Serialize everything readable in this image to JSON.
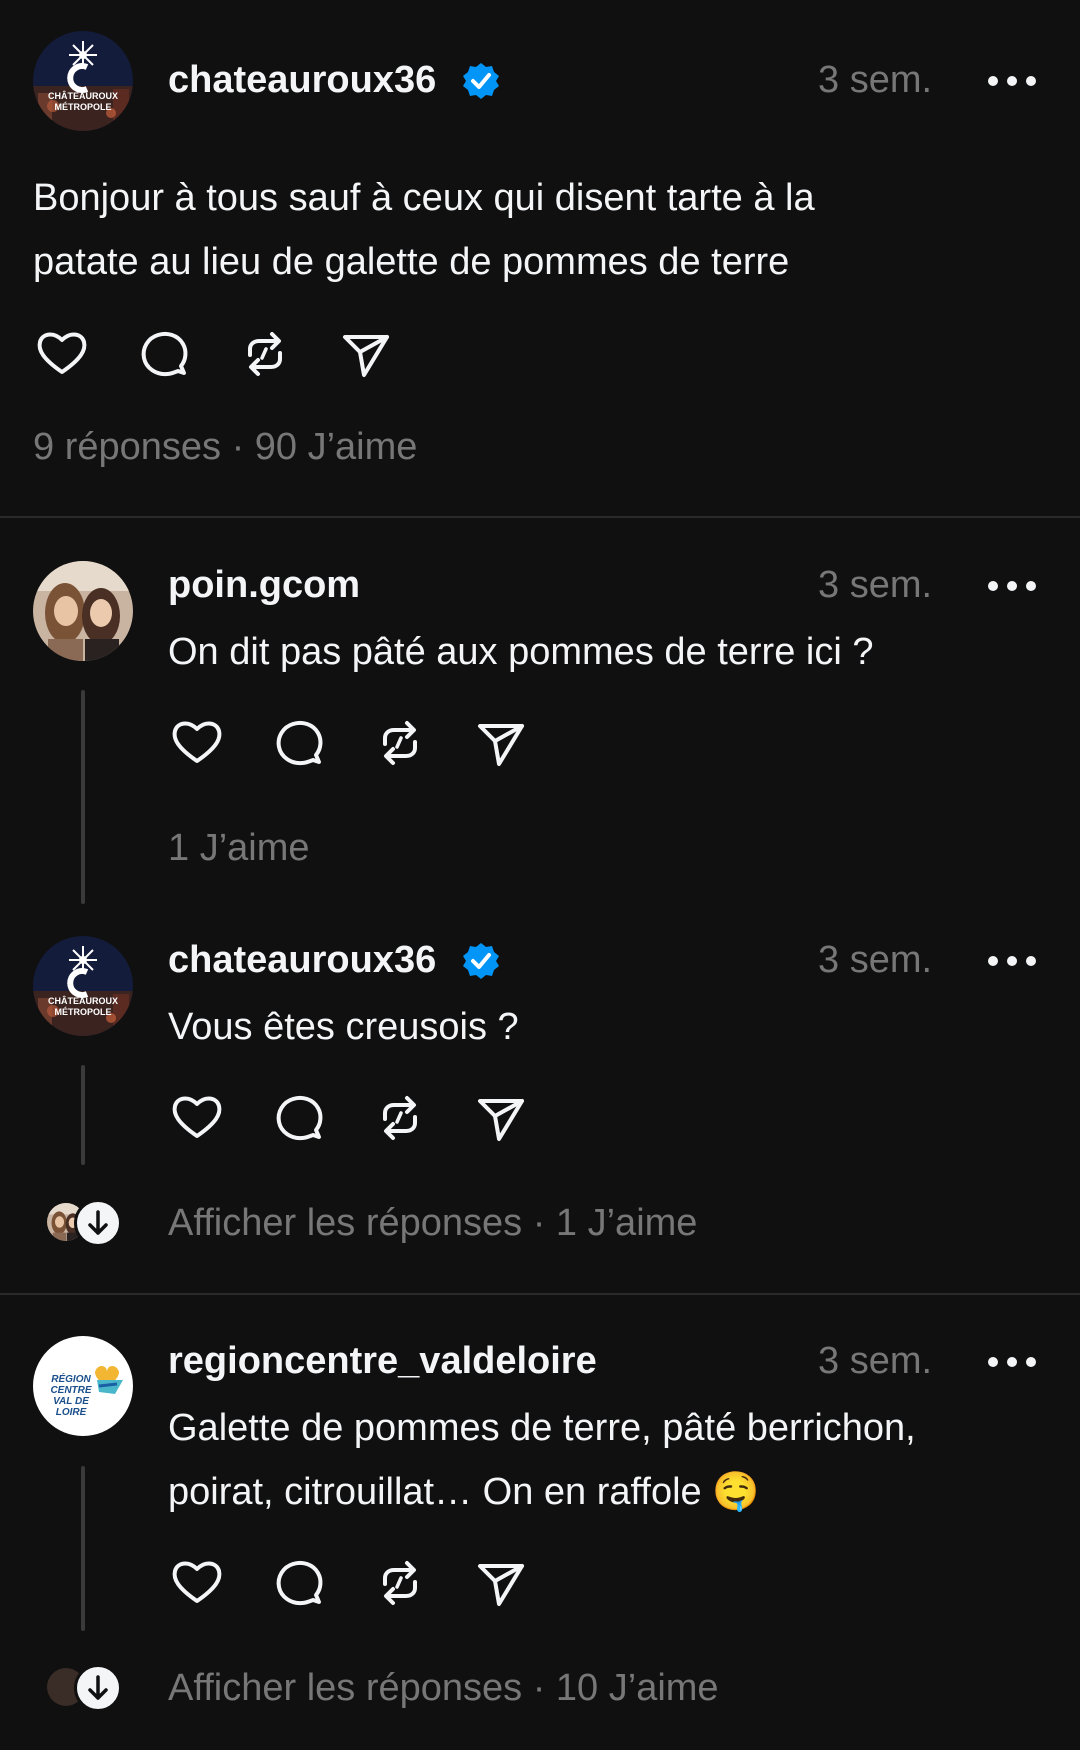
{
  "colors": {
    "background": "#101010",
    "text": "#f3f5f7",
    "muted": "#777777",
    "verified": "#0095f6",
    "divider": "#2a2a2a"
  },
  "post": {
    "username": "chateauroux36",
    "time": "3 sem.",
    "line1": "Bonjour à tous sauf à ceux qui disent tarte à la",
    "line2": "patate au lieu de galette de pommes de terre",
    "meta": "9 réponses · 90 J’aime",
    "avatar_text1": "CHÂTEAUROUX",
    "avatar_text2": "MÉTROPOLE"
  },
  "reply1": {
    "username": "poin.gcom",
    "time": "3 sem.",
    "text": "On dit pas pâté aux pommes de terre ici ?",
    "meta": "1 J’aime"
  },
  "reply2": {
    "username": "chateauroux36",
    "time": "3 sem.",
    "text": "Vous êtes creusois ?",
    "meta": "Afficher les réponses · 1 J’aime",
    "avatar_text1": "CHÂTEAUROUX",
    "avatar_text2": "MÉTROPOLE"
  },
  "reply3": {
    "username": "regioncentre_valdeloire",
    "time": "3 sem.",
    "line1": "Galette de pommes de terre, pâté berrichon,",
    "line2": "poirat, citrouillat… On en raffole",
    "emoji": "🤤",
    "meta": "Afficher les réponses · 10 J’aime",
    "avatar_text1": "RÉGION",
    "avatar_text2": "CENTRE",
    "avatar_text3": "VAL DE LOIRE"
  },
  "icons": [
    "heart-icon",
    "comment-icon",
    "repost-icon",
    "share-icon",
    "more-icon",
    "verified-icon",
    "arrow-down-icon"
  ]
}
